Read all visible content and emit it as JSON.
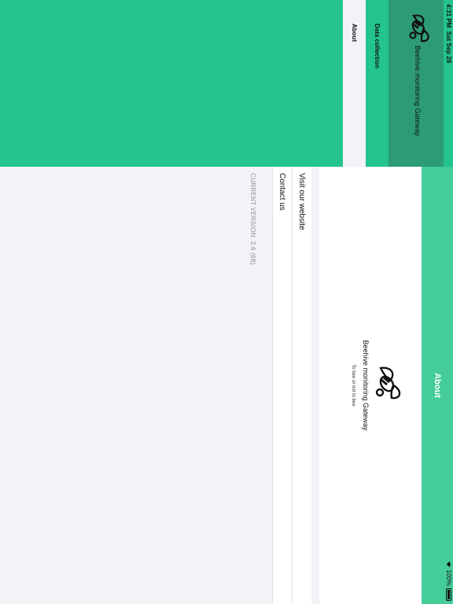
{
  "status_bar": {
    "time": "4:31 PM",
    "date": "Sat Sep 28",
    "battery": "100%"
  },
  "sidebar": {
    "app_title": "Beehive monitoring Gateway",
    "items": [
      {
        "label": "Data collection"
      },
      {
        "label": "About",
        "selected": true
      }
    ]
  },
  "detail": {
    "nav_title": "About",
    "app_name": "Beehive monitoring Gateway",
    "tagline": "To bee or not to bee",
    "links": [
      {
        "label": "Visit our website"
      },
      {
        "label": "Contact us"
      }
    ],
    "version": "CURRENT VERSION:  2.6 (68)"
  },
  "colors": {
    "accent": "#44cc99",
    "sidebar": "#23c48d",
    "sidebar_header": "#2d9b78"
  }
}
